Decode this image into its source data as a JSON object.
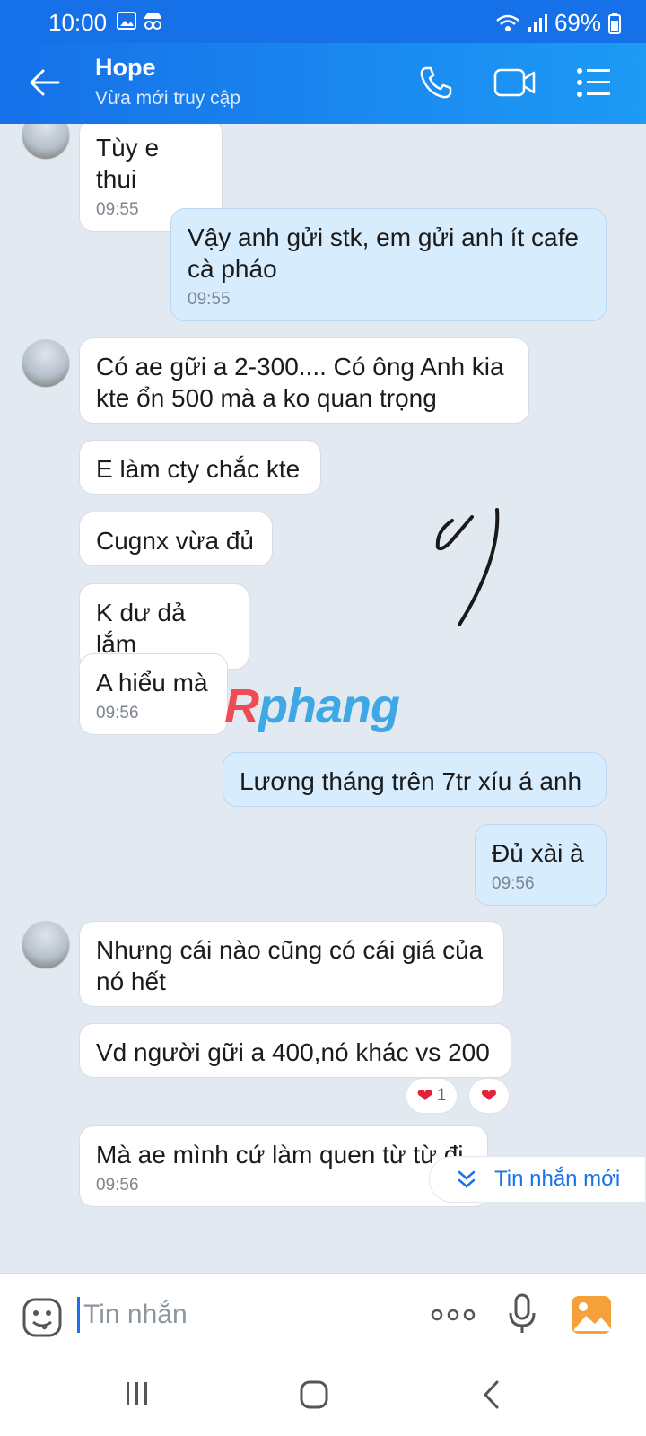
{
  "status": {
    "time": "10:00",
    "battery": "69%"
  },
  "header": {
    "name": "Hope",
    "status": "Vừa mới truy cập"
  },
  "messages": [
    {
      "text": "Tùy e thui",
      "time": "09:55"
    },
    {
      "text": "Vậy anh gửi stk, em gửi anh ít cafe cà pháo",
      "time": "09:55"
    },
    {
      "text": "Có ae gữi a 2-300.... Có ông Anh kia kte ổn 500 mà a ko quan trọng"
    },
    {
      "text": "E làm cty chắc kte"
    },
    {
      "text": "Cugnx vừa đủ"
    },
    {
      "text": "K dư dả lắm"
    },
    {
      "text": "A hiểu mà",
      "time": "09:56"
    },
    {
      "text": "Lương tháng trên 7tr xíu á anh"
    },
    {
      "text": "Đủ xài à",
      "time": "09:56"
    },
    {
      "text": "Nhưng cái nào cũng có cái giá của nó hết"
    },
    {
      "text": "Vd người gữi a 400,nó khác vs 200",
      "reaction_count": "1"
    },
    {
      "text": "Mà ae mình cứ làm quen từ từ đi",
      "time": "09:56"
    }
  ],
  "new_message_label": "Tin nhắn mới",
  "watermark": {
    "part1": "R",
    "part2": "phang"
  },
  "input": {
    "placeholder": "Tin nhắn"
  },
  "icons": {
    "back": "back-arrow-icon",
    "call": "phone-icon",
    "video": "video-call-icon",
    "menu": "list-menu-icon",
    "emoji": "emoji-icon",
    "more": "more-dots-icon",
    "mic": "microphone-icon",
    "image": "image-icon"
  },
  "colors": {
    "header": "#1670e8",
    "outgoing_bubble": "#d7ecfd",
    "incoming_bubble": "#ffffff",
    "accent": "#1a73e8"
  }
}
